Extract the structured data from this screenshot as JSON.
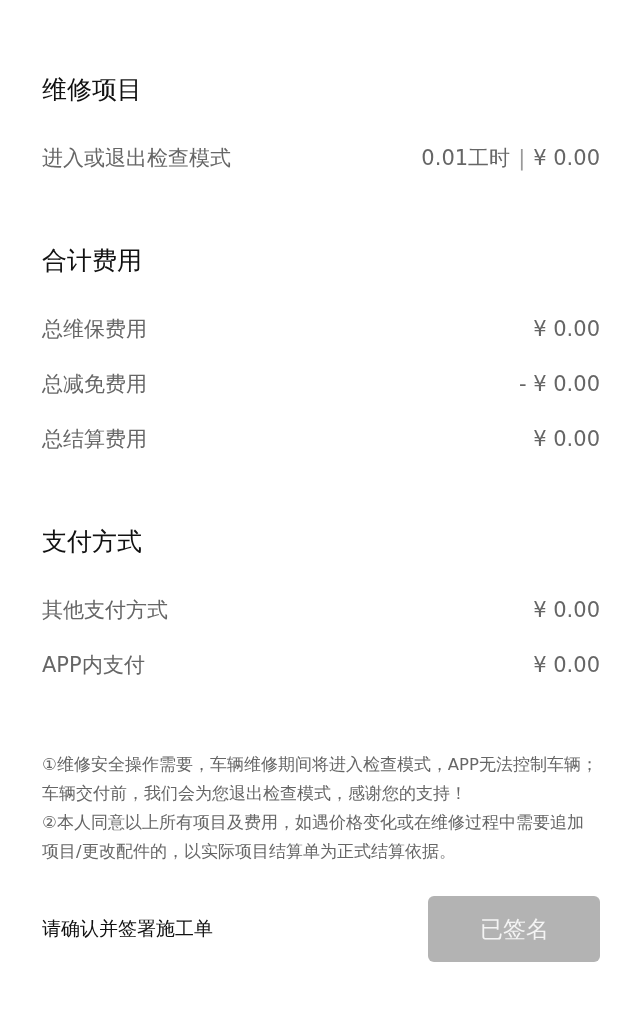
{
  "sections": [
    {
      "title": "维修项目",
      "rows": [
        {
          "label": "进入或退出检查模式",
          "hours": "0.01工时",
          "separator": "|",
          "amount": "¥ 0.00"
        }
      ]
    },
    {
      "title": "合计费用",
      "rows": [
        {
          "label": "总维保费用",
          "amount": "¥ 0.00"
        },
        {
          "label": "总减免费用",
          "amount": "- ¥ 0.00"
        },
        {
          "label": "总结算费用",
          "amount": "¥ 0.00"
        }
      ]
    },
    {
      "title": "支付方式",
      "rows": [
        {
          "label": "其他支付方式",
          "amount": "¥ 0.00"
        },
        {
          "label": "APP内支付",
          "amount": "¥ 0.00"
        }
      ]
    }
  ],
  "notes": [
    "①维修安全操作需要，车辆维修期间将进入检查模式，APP无法控制车辆；车辆交付前，我们会为您退出检查模式，感谢您的支持！",
    "②本人同意以上所有项目及费用，如遇价格变化或在维修过程中需要追加项目/更改配件的，以实际项目结算单为正式结算依据。"
  ],
  "footer": {
    "prompt": "请确认并签署施工单",
    "button": {
      "label": "已签名",
      "disabled": true
    }
  }
}
